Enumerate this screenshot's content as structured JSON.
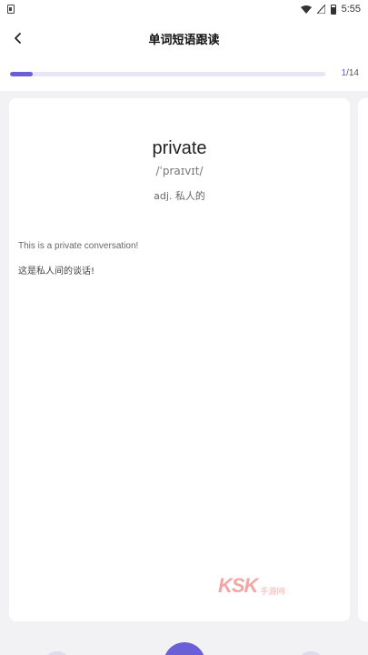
{
  "status_bar": {
    "time": "5:55",
    "icons": [
      "sim-card-icon",
      "wifi-icon",
      "signal-icon",
      "battery-icon"
    ]
  },
  "header": {
    "title": "单词短语跟读",
    "back_icon": "chevron-left-icon"
  },
  "progress": {
    "current": "1",
    "total": "/14",
    "fraction": 0.071,
    "fill_color": "#6a5fd6"
  },
  "card": {
    "word": "private",
    "phonetic": "/ˈpraɪvɪt/",
    "definition": "adj. 私人的",
    "example_en": "This is a private conversation!",
    "example_zh": "这是私人间的谈话!"
  },
  "watermark": {
    "logo": "KSK",
    "tagline": "手游网"
  },
  "colors": {
    "accent": "#6a5fd6",
    "background": "#f2f2f4"
  }
}
